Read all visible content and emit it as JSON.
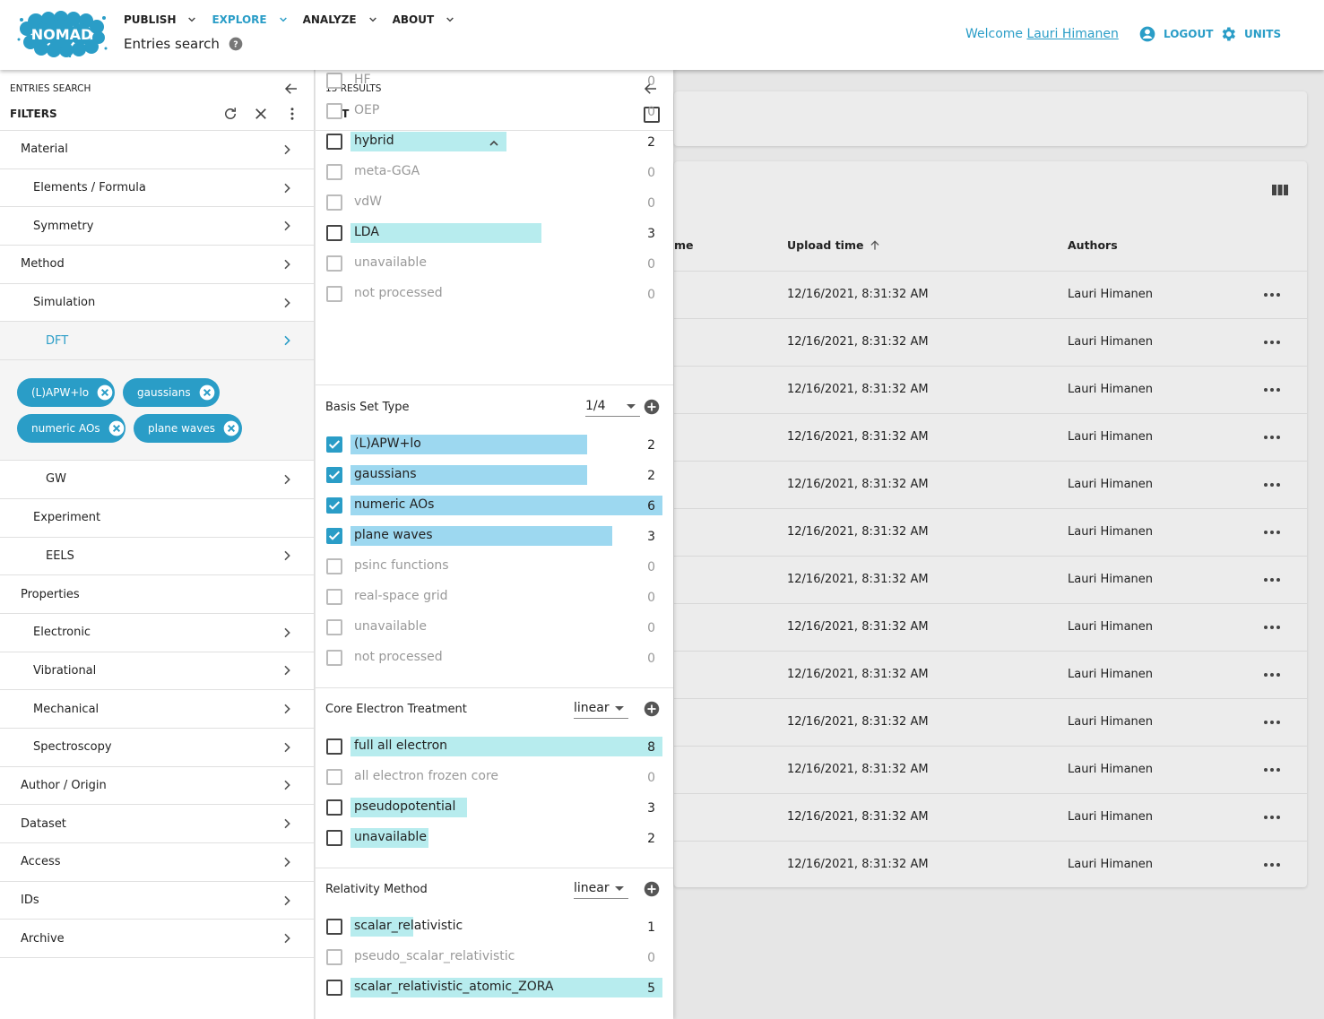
{
  "header": {
    "logo_text": "NOMAD",
    "nav": [
      {
        "label": "PUBLISH"
      },
      {
        "label": "EXPLORE"
      },
      {
        "label": "ANALYZE"
      },
      {
        "label": "ABOUT"
      }
    ],
    "page_title": "Entries search",
    "welcome_prefix": "Welcome ",
    "user_name": "Lauri Himanen",
    "logout_label": "LOGOUT",
    "units_label": "UNITS",
    "accent_color": "#2a9dc7"
  },
  "filters": {
    "overline": "ENTRIES SEARCH",
    "title": "FILTERS",
    "items": [
      {
        "label": "Material"
      },
      {
        "label": "Elements / Formula"
      },
      {
        "label": "Symmetry"
      },
      {
        "label": "Method"
      },
      {
        "label": "Simulation"
      },
      {
        "label": "DFT"
      },
      {
        "label": "GW"
      },
      {
        "label": "Experiment"
      },
      {
        "label": "EELS"
      },
      {
        "label": "Properties"
      },
      {
        "label": "Electronic"
      },
      {
        "label": "Vibrational"
      },
      {
        "label": "Mechanical"
      },
      {
        "label": "Spectroscopy"
      },
      {
        "label": "Author / Origin"
      },
      {
        "label": "Dataset"
      },
      {
        "label": "Access"
      },
      {
        "label": "IDs"
      },
      {
        "label": "Archive"
      }
    ],
    "chips": [
      {
        "label": "(L)APW+lo"
      },
      {
        "label": "gaussians"
      },
      {
        "label": "numeric AOs"
      },
      {
        "label": "plane waves"
      }
    ]
  },
  "dft_panel": {
    "overline": "13 RESULTS",
    "title": "DFT",
    "xc_options": [
      {
        "label": "HF",
        "count": "0"
      },
      {
        "label": "OEP",
        "count": "0"
      },
      {
        "label": "hybrid",
        "count": "2"
      },
      {
        "label": "meta-GGA",
        "count": "0"
      },
      {
        "label": "vdW",
        "count": "0"
      },
      {
        "label": "LDA",
        "count": "3"
      },
      {
        "label": "unavailable",
        "count": "0"
      },
      {
        "label": "not processed",
        "count": "0"
      }
    ],
    "basis": {
      "title": "Basis Set Type",
      "scale": "1/4",
      "options": [
        {
          "label": "(L)APW+lo",
          "count": "2"
        },
        {
          "label": "gaussians",
          "count": "2"
        },
        {
          "label": "numeric AOs",
          "count": "6"
        },
        {
          "label": "plane waves",
          "count": "3"
        },
        {
          "label": "psinc functions",
          "count": "0"
        },
        {
          "label": "real-space grid",
          "count": "0"
        },
        {
          "label": "unavailable",
          "count": "0"
        },
        {
          "label": "not processed",
          "count": "0"
        }
      ]
    },
    "core": {
      "title": "Core Electron Treatment",
      "scale": "linear",
      "options": [
        {
          "label": "full all electron",
          "count": "8"
        },
        {
          "label": "all electron frozen core",
          "count": "0"
        },
        {
          "label": "pseudopotential",
          "count": "3"
        },
        {
          "label": "unavailable",
          "count": "2"
        }
      ]
    },
    "relativity": {
      "title": "Relativity Method",
      "scale": "linear",
      "options": [
        {
          "label": "scalar_relativistic",
          "count": "1"
        },
        {
          "label": "pseudo_scalar_relativistic",
          "count": "0"
        },
        {
          "label": "scalar_relativistic_atomic_ZORA",
          "count": "5"
        }
      ]
    }
  },
  "results": {
    "col_partial": "me",
    "col_upload": "Upload time",
    "col_authors": "Authors",
    "rows": [
      {
        "upload": "12/16/2021, 8:31:32 AM",
        "author": "Lauri Himanen"
      },
      {
        "upload": "12/16/2021, 8:31:32 AM",
        "author": "Lauri Himanen"
      },
      {
        "upload": "12/16/2021, 8:31:32 AM",
        "author": "Lauri Himanen"
      },
      {
        "upload": "12/16/2021, 8:31:32 AM",
        "author": "Lauri Himanen"
      },
      {
        "upload": "12/16/2021, 8:31:32 AM",
        "author": "Lauri Himanen"
      },
      {
        "upload": "12/16/2021, 8:31:32 AM",
        "author": "Lauri Himanen"
      },
      {
        "upload": "12/16/2021, 8:31:32 AM",
        "author": "Lauri Himanen"
      },
      {
        "upload": "12/16/2021, 8:31:32 AM",
        "author": "Lauri Himanen"
      },
      {
        "upload": "12/16/2021, 8:31:32 AM",
        "author": "Lauri Himanen"
      },
      {
        "upload": "12/16/2021, 8:31:32 AM",
        "author": "Lauri Himanen"
      },
      {
        "upload": "12/16/2021, 8:31:32 AM",
        "author": "Lauri Himanen"
      },
      {
        "upload": "12/16/2021, 8:31:32 AM",
        "author": "Lauri Himanen"
      },
      {
        "upload": "12/16/2021, 8:31:32 AM",
        "author": "Lauri Himanen"
      }
    ]
  }
}
